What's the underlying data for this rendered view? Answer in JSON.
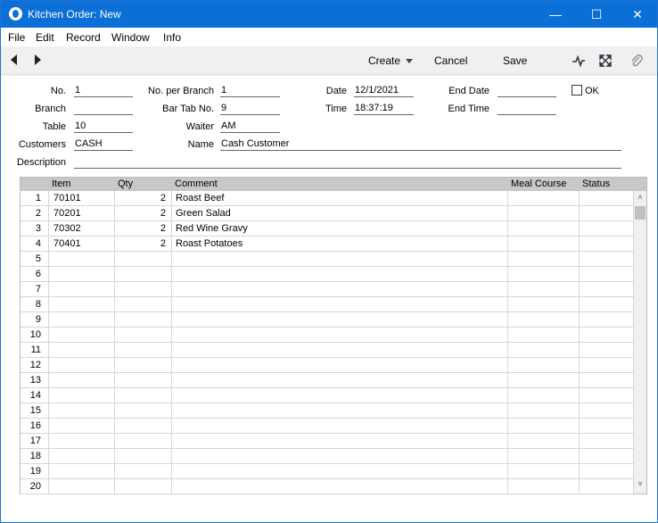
{
  "window": {
    "title": "Kitchen Order: New"
  },
  "window_controls": {
    "minimize": "—",
    "maximize": "☐",
    "close": "✕"
  },
  "menu": [
    "File",
    "Edit",
    "Record",
    "Window",
    "Info"
  ],
  "toolbar": {
    "create": "Create",
    "cancel": "Cancel",
    "save": "Save"
  },
  "fields": {
    "no": {
      "label": "No.",
      "value": "1"
    },
    "no_per_branch": {
      "label": "No. per Branch",
      "value": "1"
    },
    "date": {
      "label": "Date",
      "value": "12/1/2021"
    },
    "end_date": {
      "label": "End Date",
      "value": ""
    },
    "ok": {
      "label": "OK",
      "checked": false
    },
    "branch": {
      "label": "Branch",
      "value": ""
    },
    "bar_tab_no": {
      "label": "Bar Tab No.",
      "value": "9"
    },
    "time": {
      "label": "Time",
      "value": "18:37:19"
    },
    "end_time": {
      "label": "End Time",
      "value": ""
    },
    "table": {
      "label": "Table",
      "value": "10"
    },
    "waiter": {
      "label": "Waiter",
      "value": "AM"
    },
    "customers": {
      "label": "Customers",
      "value": "CASH"
    },
    "name": {
      "label": "Name",
      "value": "Cash Customer"
    },
    "description": {
      "label": "Description",
      "value": ""
    }
  },
  "grid": {
    "columns": [
      "Item",
      "Qty",
      "Comment",
      "Meal Course",
      "Status"
    ],
    "rows": [
      {
        "num": "1",
        "item": "70101",
        "qty": "2",
        "comment": "Roast Beef",
        "meal": "",
        "status": ""
      },
      {
        "num": "2",
        "item": "70201",
        "qty": "2",
        "comment": "Green Salad",
        "meal": "",
        "status": ""
      },
      {
        "num": "3",
        "item": "70302",
        "qty": "2",
        "comment": "Red Wine Gravy",
        "meal": "",
        "status": ""
      },
      {
        "num": "4",
        "item": "70401",
        "qty": "2",
        "comment": "Roast Potatoes",
        "meal": "",
        "status": ""
      },
      {
        "num": "5",
        "item": "",
        "qty": "",
        "comment": "",
        "meal": "",
        "status": ""
      },
      {
        "num": "6",
        "item": "",
        "qty": "",
        "comment": "",
        "meal": "",
        "status": ""
      },
      {
        "num": "7",
        "item": "",
        "qty": "",
        "comment": "",
        "meal": "",
        "status": ""
      },
      {
        "num": "8",
        "item": "",
        "qty": "",
        "comment": "",
        "meal": "",
        "status": ""
      },
      {
        "num": "9",
        "item": "",
        "qty": "",
        "comment": "",
        "meal": "",
        "status": ""
      },
      {
        "num": "10",
        "item": "",
        "qty": "",
        "comment": "",
        "meal": "",
        "status": ""
      },
      {
        "num": "11",
        "item": "",
        "qty": "",
        "comment": "",
        "meal": "",
        "status": ""
      },
      {
        "num": "12",
        "item": "",
        "qty": "",
        "comment": "",
        "meal": "",
        "status": ""
      },
      {
        "num": "13",
        "item": "",
        "qty": "",
        "comment": "",
        "meal": "",
        "status": ""
      },
      {
        "num": "14",
        "item": "",
        "qty": "",
        "comment": "",
        "meal": "",
        "status": ""
      },
      {
        "num": "15",
        "item": "",
        "qty": "",
        "comment": "",
        "meal": "",
        "status": ""
      },
      {
        "num": "16",
        "item": "",
        "qty": "",
        "comment": "",
        "meal": "",
        "status": ""
      },
      {
        "num": "17",
        "item": "",
        "qty": "",
        "comment": "",
        "meal": "",
        "status": ""
      },
      {
        "num": "18",
        "item": "",
        "qty": "",
        "comment": "",
        "meal": "",
        "status": ""
      },
      {
        "num": "19",
        "item": "",
        "qty": "",
        "comment": "",
        "meal": "",
        "status": ""
      },
      {
        "num": "20",
        "item": "",
        "qty": "",
        "comment": "",
        "meal": "",
        "status": ""
      }
    ]
  },
  "icons": {
    "app": "app-logo-icon",
    "prev": "previous-record-icon",
    "next": "next-record-icon",
    "activity": "activity-icon",
    "expand": "expand-icon",
    "attach": "paperclip-icon"
  },
  "colors": {
    "titlebar": "#0a6fd6",
    "grid_header": "#c8c8c8"
  }
}
